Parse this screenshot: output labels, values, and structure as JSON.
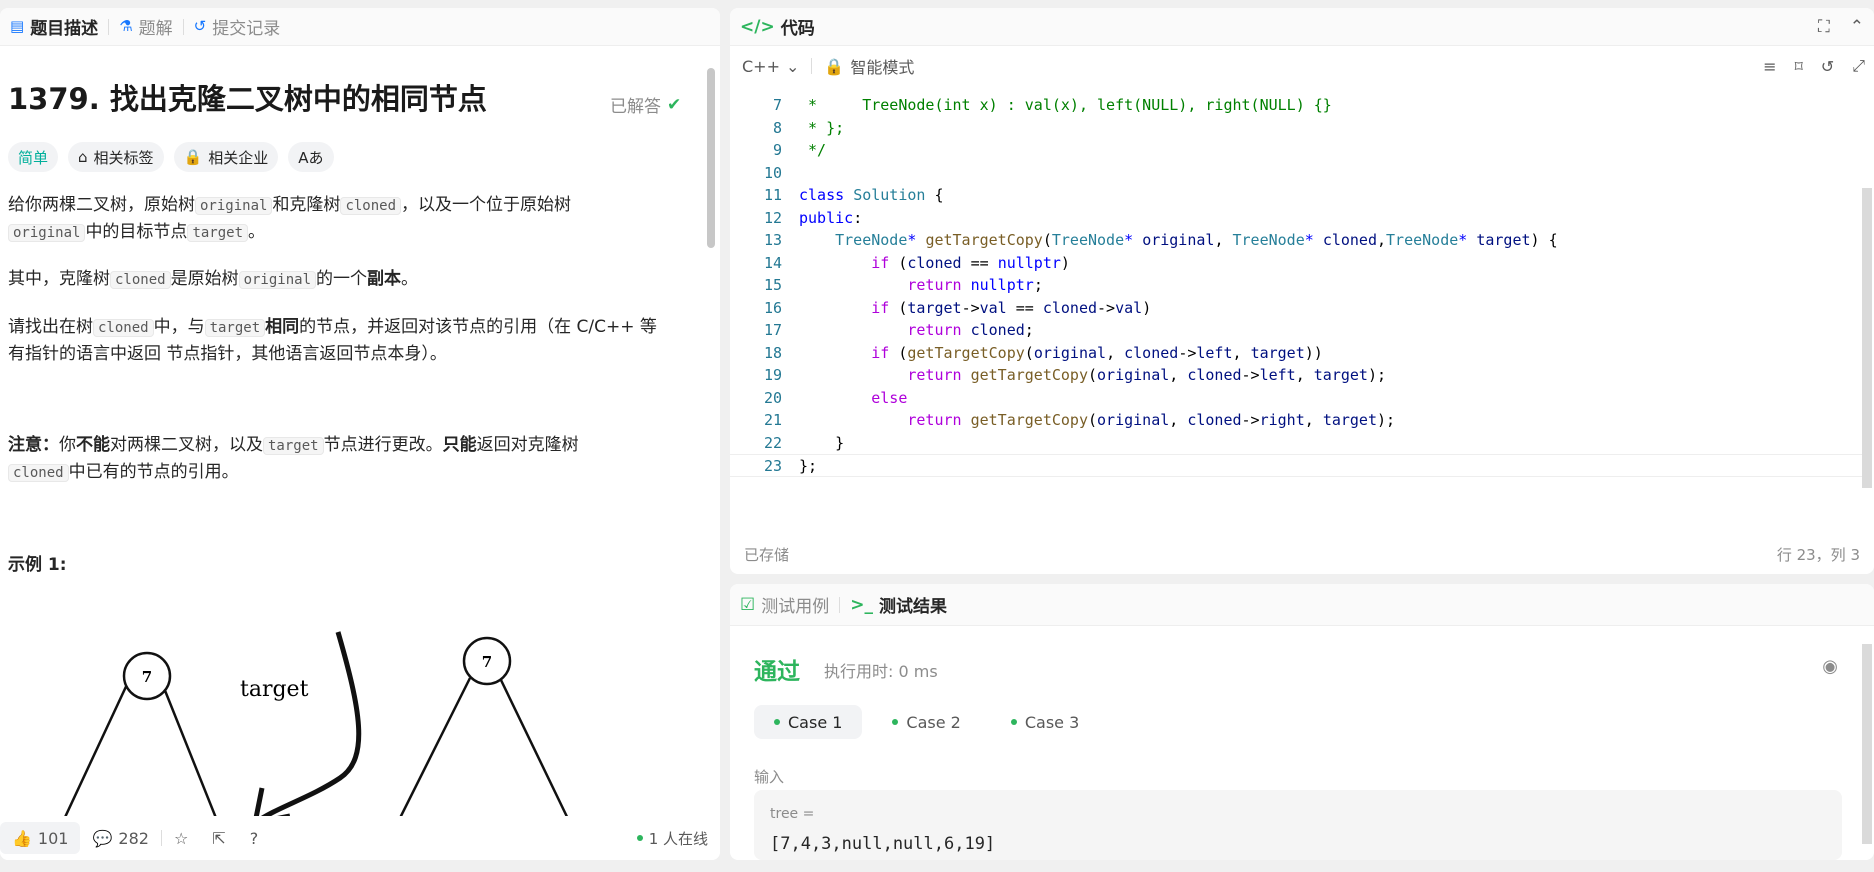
{
  "left": {
    "tabs": [
      {
        "label": "题目描述"
      },
      {
        "label": "题解"
      },
      {
        "label": "提交记录"
      }
    ],
    "title": "1379. 找出克隆二叉树中的相同节点",
    "solved_label": "已解答",
    "tags": {
      "difficulty": "简单",
      "topics": "相关标签",
      "companies": "相关企业",
      "font": "Aあ"
    },
    "desc": {
      "p1_a": "给你两棵二叉树，原始树",
      "p1_b": "和克隆树",
      "p1_c": "，以及一个位于原始树",
      "p1_d": "中的目标节点",
      "p1_e": "。",
      "code_original": "original",
      "code_cloned": "cloned",
      "code_target": "target",
      "p2_a": "其中，克隆树",
      "p2_b": "是原始树",
      "p2_c": "的一个",
      "p2_bold": "副本",
      "p2_d": "。",
      "p3_a": "请找出在树",
      "p3_b": "中，与",
      "p3_bold": "相同",
      "p3_c": "的节点，并返回对该节点的引用（在 C/C++ 等有指针的语言中返回 节点指针，其他语言返回节点本身）。",
      "p4_label": "注意：",
      "p4_a": "你",
      "p4_bold1": "不能",
      "p4_b": "对两棵二叉树，以及",
      "p4_c": "节点进行更改。",
      "p4_bold2": "只能",
      "p4_d": "返回对克隆树",
      "p4_e": "中已有的节点的引用。",
      "example_title": "示例 1:"
    },
    "figure": {
      "node_left_root": "7",
      "node_right_root": "7",
      "target_label": "target"
    },
    "footer": {
      "likes": "101",
      "comments": "282",
      "online": "1 人在线"
    }
  },
  "editor": {
    "title": "代码",
    "language": "C++",
    "mode": "智能模式",
    "saved": "已存储",
    "position": "行 23，列 3"
  },
  "results": {
    "tabs": [
      {
        "label": "测试用例"
      },
      {
        "label": "测试结果"
      }
    ],
    "status": "通过",
    "runtime": "执行用时: 0 ms",
    "cases": [
      "Case 1",
      "Case 2",
      "Case 3"
    ],
    "input_label": "输入",
    "var_name": "tree =",
    "var_value": "[7,4,3,null,null,6,19]"
  },
  "colors": {
    "accent_green": "#2db55d",
    "easy": "#00af9b"
  }
}
